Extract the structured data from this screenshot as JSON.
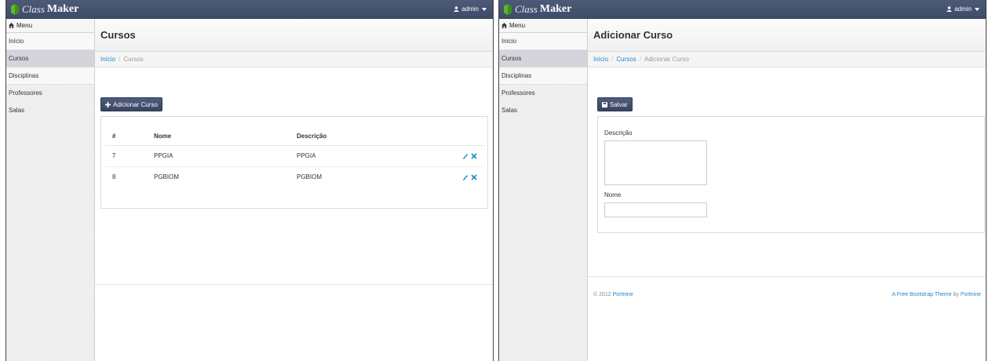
{
  "brand": {
    "class": "Class",
    "maker": "Maker"
  },
  "user": {
    "name": "admin"
  },
  "sidebar": {
    "header": "Menu",
    "items": [
      {
        "label": "Início"
      },
      {
        "label": "Cursos"
      },
      {
        "label": "Disciplinas"
      },
      {
        "label": "Professores"
      },
      {
        "label": "Salas"
      }
    ]
  },
  "left": {
    "title": "Cursos",
    "breadcrumb": {
      "home": "Início",
      "current": "Cursos"
    },
    "add_button": "Adicionar Curso",
    "table": {
      "headers": [
        "#",
        "Nome",
        "Descrição"
      ],
      "rows": [
        {
          "id": "7",
          "nome": "PPGIA",
          "descricao": "PPGIA"
        },
        {
          "id": "8",
          "nome": "PGBIOM",
          "descricao": "PGBIOM"
        }
      ]
    }
  },
  "right": {
    "title": "Adicionar Curso",
    "breadcrumb": {
      "home": "Início",
      "middle": "Cursos",
      "current": "Adicionar Curso"
    },
    "save_button": "Salvar",
    "form": {
      "descricao_label": "Descrição",
      "descricao_value": "",
      "nome_label": "Nome",
      "nome_value": ""
    },
    "footer": {
      "copyright": "© 2012",
      "copyright_link": "Portnine",
      "theme_link": "A Free Bootstrap Theme",
      "by": "by",
      "author_link": "Portnine"
    }
  },
  "colors": {
    "navbar": "#46536f",
    "link": "#1d87c9",
    "sidebar_active": "#d4d5dc"
  }
}
